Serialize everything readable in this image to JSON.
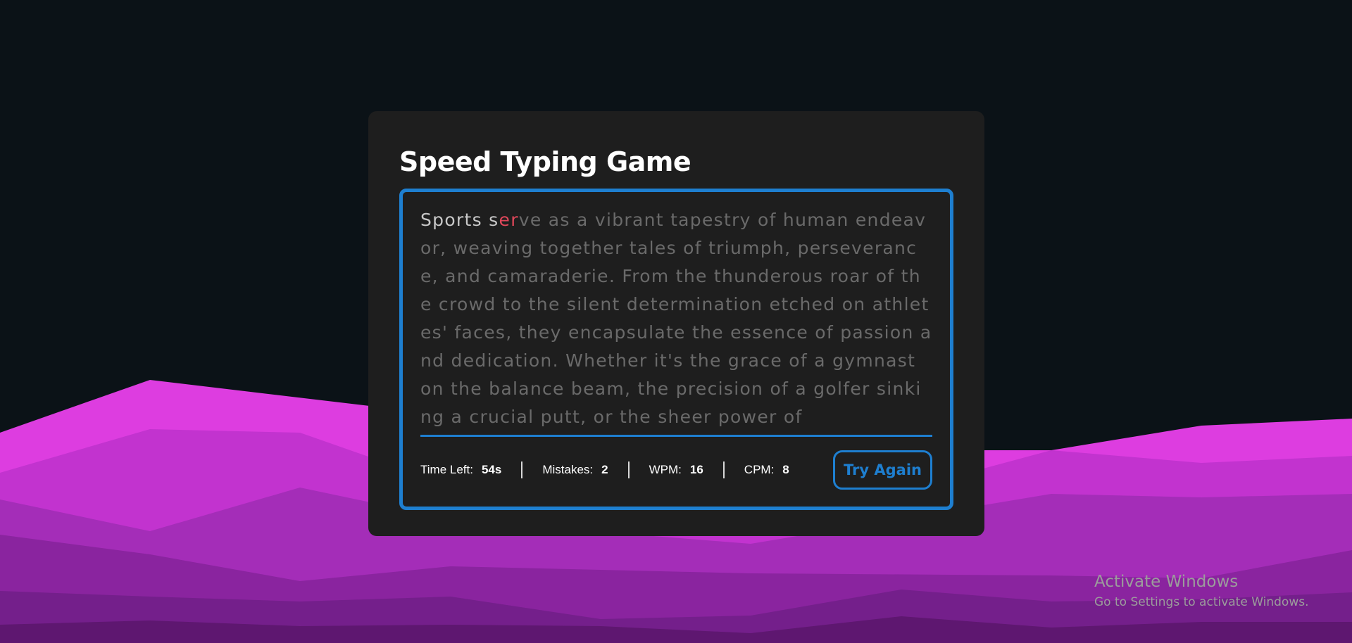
{
  "game": {
    "title": "Speed Typing Game",
    "paragraph": {
      "typed_correct_1": "Sports s",
      "typed_wrong": "er",
      "remaining": "ve as a vibrant tapestry of human endeavor, weaving together tales of triumph, perseverance, and camaraderie. From the thunderous roar of the crowd to the silent determination etched on athletes' faces, they encapsulate the essence of passion and dedication. Whether it's the grace of a gymnast on the balance beam, the precision of a golfer sinking a crucial putt, or the sheer power of"
    },
    "stats": {
      "time_left_label": "Time Left:",
      "time_left_value": "54s",
      "mistakes_label": "Mistakes:",
      "mistakes_value": "2",
      "wpm_label": "WPM:",
      "wpm_value": "16",
      "cpm_label": "CPM:",
      "cpm_value": "8"
    },
    "try_again_label": "Try Again"
  },
  "watermark": {
    "title": "Activate Windows",
    "subtitle": "Go to Settings to activate Windows."
  },
  "colors": {
    "page_bg": "#0b1217",
    "card_bg": "#1e1e1e",
    "accent_blue": "#1e7fd0",
    "typed_correct": "#c8c8c8",
    "typed_wrong": "#e0475a",
    "untyped": "#6a6a6a",
    "wave_colors": [
      "#dd3de0",
      "#c233cf",
      "#a42db8",
      "#8a249f",
      "#741f8b",
      "#5e1770"
    ]
  }
}
